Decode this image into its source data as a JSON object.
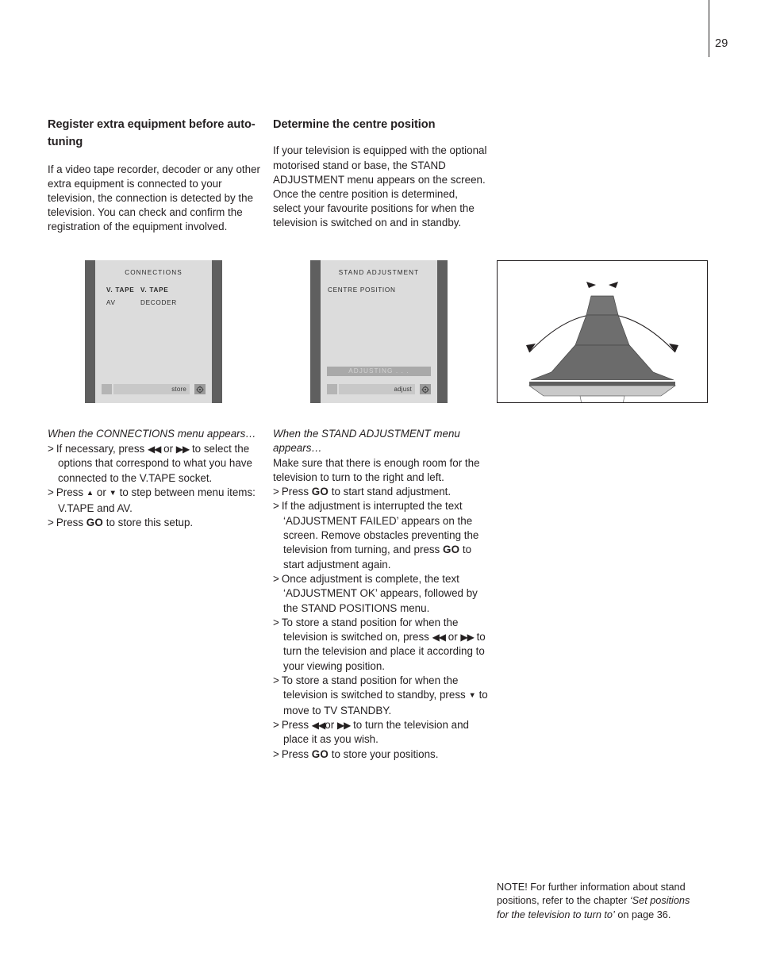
{
  "page": {
    "number": "29"
  },
  "left_column": {
    "heading": "Register extra equipment before auto-tuning",
    "body": "If a video tape recorder, decoder or any other extra equipment is connected to your television, the connection is detected by the television. You can check and confirm the registration of the equipment involved."
  },
  "mid_column": {
    "heading": "Determine the centre position",
    "body": "If your television is equipped with the optional motorised stand or base, the STAND ADJUSTMENT menu appears on the screen. Once the centre position is determined, select your favourite positions for when the television is switched on and in standby."
  },
  "connections_menu": {
    "title": "CONNECTIONS",
    "rows": [
      {
        "label": "V. TAPE",
        "value": "V. TAPE"
      },
      {
        "label": "AV",
        "value": "DECODER"
      }
    ],
    "bottom_label": "store",
    "go_icon": "go-wheel-icon"
  },
  "stand_menu": {
    "title": "STAND  ADJUSTMENT",
    "rows": [
      {
        "label": "CENTRE  POSITION"
      }
    ],
    "status_bar": "ADJUSTING . . .",
    "bottom_label": "adjust",
    "go_icon": "go-wheel-icon"
  },
  "illustration": {
    "name": "motorised-tv-stand-rotation-diagram",
    "colors": {
      "dome": "#6e6e6e",
      "column": "#7a7a7a",
      "rim": "#c9c9c9",
      "outline": "#231f20"
    }
  },
  "instructions_left": {
    "intro": "When the CONNECTIONS menu appears…",
    "items": [
      "If necessary, press ◀◀ or ▶▶ to select the options that correspond to what you have connected to the V.TAPE socket.",
      "Press ▲ or ▼ to step between menu items: V.TAPE and AV.",
      "Press GO to store this setup."
    ]
  },
  "instructions_mid": {
    "intro": "When the STAND ADJUSTMENT menu appears…",
    "lead": "Make sure that there is enough room for the television to turn to the right and left.",
    "items": [
      "Press GO to start stand adjustment.",
      "If the adjustment is interrupted the text ‘ADJUSTMENT FAILED’ appears on the screen. Remove obstacles preventing the television from turning, and press GO to start adjustment again.",
      "Once adjustment is complete, the text ‘ADJUSTMENT OK’ appears, followed by the STAND POSITIONS menu.",
      "To store a stand position for when the television is switched on, press ◀◀ or ▶▶ to turn the television and place it according to your viewing position.",
      "To store a stand position for when the television is switched to standby, press ▼ to move to TV STANDBY.",
      "Press ◀◀ or ▶▶ to turn the television and place it as you wish.",
      "Press GO to store your positions."
    ]
  },
  "note": {
    "prefix": "NOTE! For further information about stand positions, refer to the chapter ",
    "chapter": "‘Set positions for the television to turn to’",
    "suffix": " on page 36."
  }
}
